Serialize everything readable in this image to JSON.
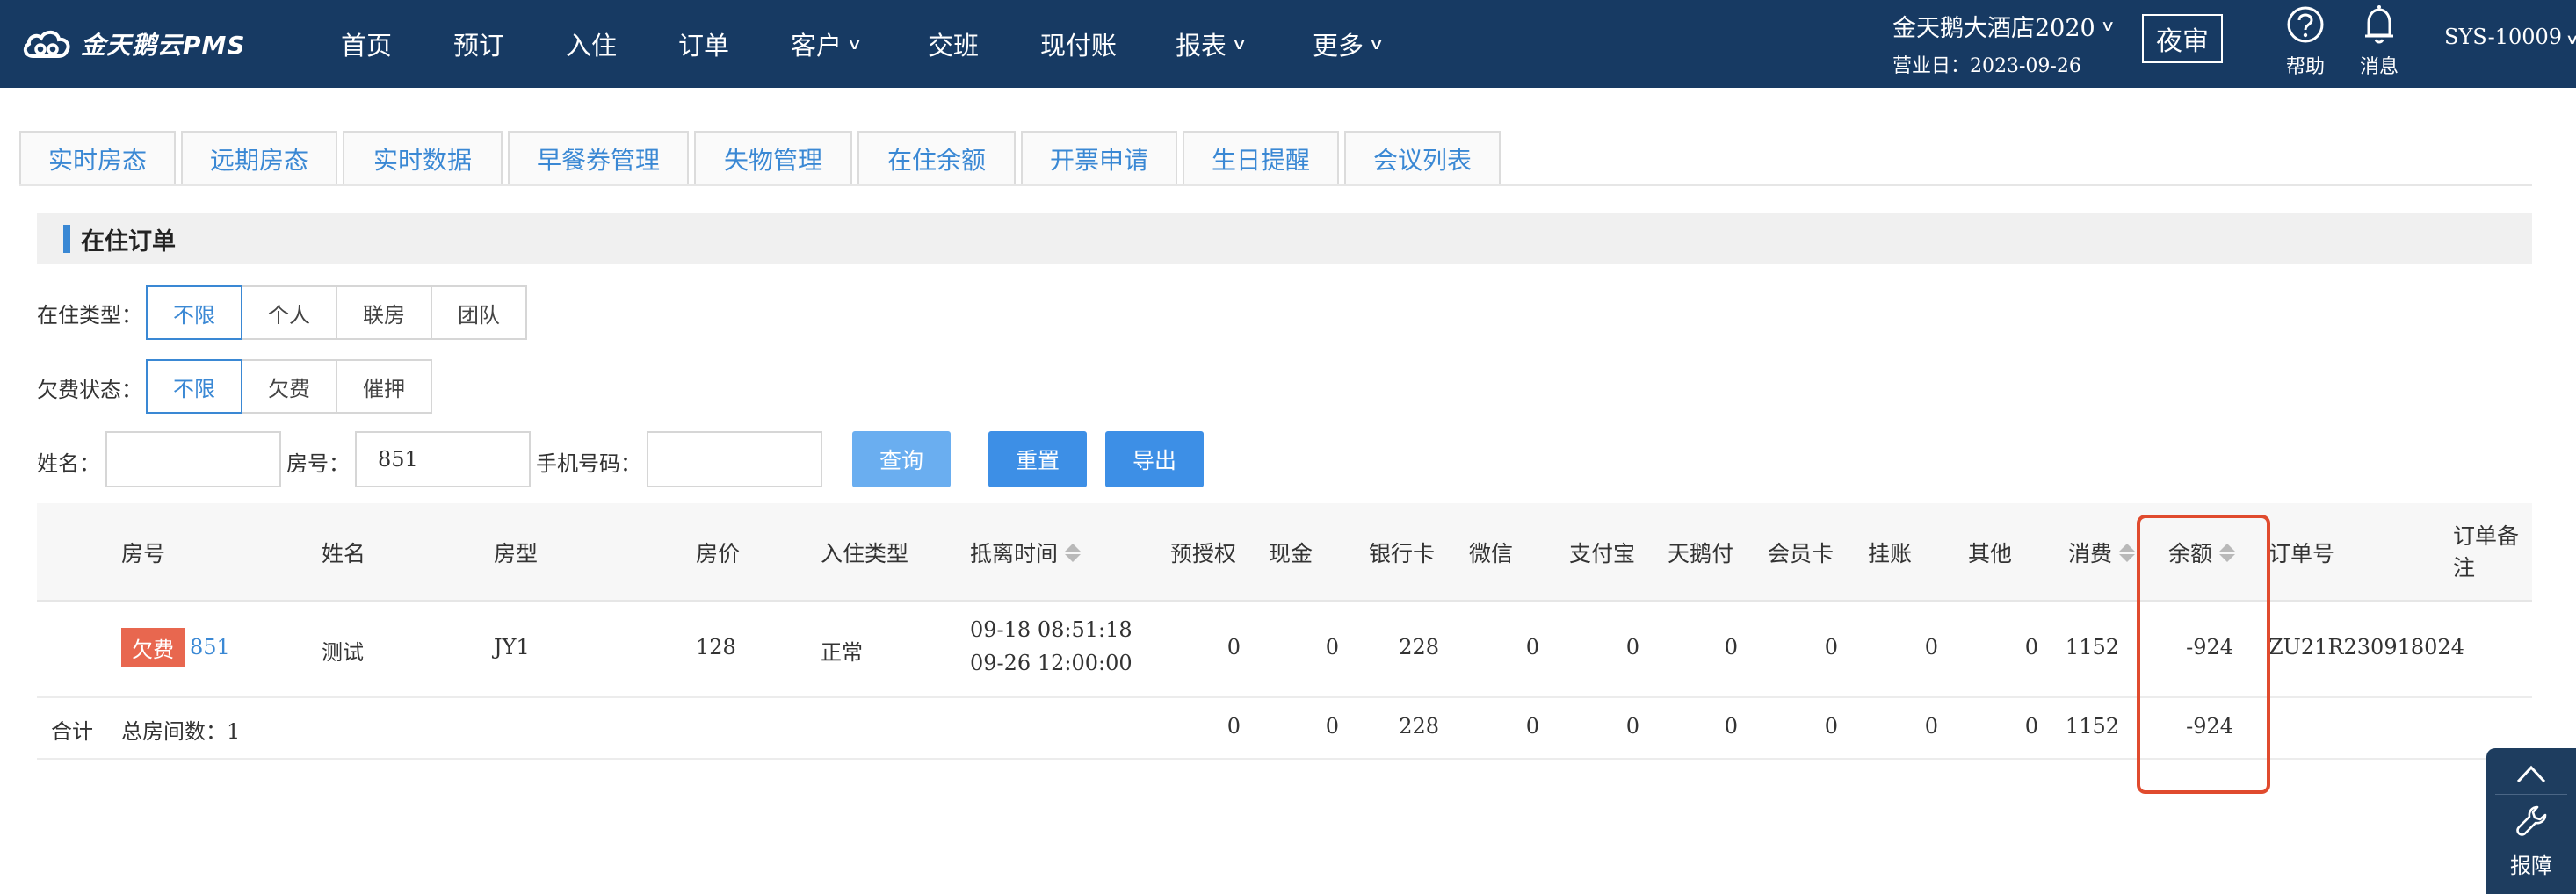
{
  "header": {
    "logo_text": "金天鹅云PMS",
    "nav": [
      {
        "label": "首页",
        "has_menu": false
      },
      {
        "label": "预订",
        "has_menu": false
      },
      {
        "label": "入住",
        "has_menu": false
      },
      {
        "label": "订单",
        "has_menu": false
      },
      {
        "label": "客户",
        "has_menu": true
      },
      {
        "label": "交班",
        "has_menu": false
      },
      {
        "label": "现付账",
        "has_menu": false
      },
      {
        "label": "报表",
        "has_menu": true
      },
      {
        "label": "更多",
        "has_menu": true
      }
    ],
    "hotel_name": "金天鹅大酒店2020",
    "business_date": "营业日：2023-09-26",
    "audit_label": "夜审",
    "help_label": "帮助",
    "message_label": "消息",
    "user": "SYS-10009"
  },
  "tabs": [
    "实时房态",
    "远期房态",
    "实时数据",
    "早餐券管理",
    "失物管理",
    "在住余额",
    "开票申请",
    "生日提醒",
    "会议列表"
  ],
  "section_title": "在住订单",
  "filters": {
    "stay_type_label": "在住类型：",
    "stay_type_options": [
      "不限",
      "个人",
      "联房",
      "团队"
    ],
    "arrears_label": "欠费状态：",
    "arrears_options": [
      "不限",
      "欠费",
      "催押"
    ],
    "name_label": "姓名：",
    "name_value": "",
    "room_label": "房号：",
    "room_value": "851",
    "phone_label": "手机号码：",
    "phone_value": ""
  },
  "buttons": {
    "query": "查询",
    "reset": "重置",
    "export": "导出"
  },
  "table": {
    "columns": [
      "房号",
      "姓名",
      "房型",
      "房价",
      "入住类型",
      "抵离时间",
      "预授权",
      "现金",
      "银行卡",
      "微信",
      "支付宝",
      "天鹅付",
      "会员卡",
      "挂账",
      "其他",
      "消费",
      "余额",
      "订单号",
      "订单备注"
    ],
    "rows": [
      {
        "badge": "欠费",
        "room": "851",
        "name": "测试",
        "room_type": "JY1",
        "price": "128",
        "stay_type": "正常",
        "arrival": "09-18 08:51:18",
        "departure": "09-26 12:00:00",
        "preauth": "0",
        "cash": "0",
        "bank_card": "228",
        "wechat": "0",
        "alipay": "0",
        "swan_pay": "0",
        "member_card": "0",
        "on_account": "0",
        "other": "0",
        "consumption": "1152",
        "balance": "-924",
        "order_no": "ZU21R230918024",
        "remark": ""
      }
    ],
    "total": {
      "label": "合计",
      "room_count": "总房间数：1",
      "preauth": "0",
      "cash": "0",
      "bank_card": "228",
      "wechat": "0",
      "alipay": "0",
      "swan_pay": "0",
      "member_card": "0",
      "on_account": "0",
      "other": "0",
      "consumption": "1152",
      "balance": "-924"
    }
  },
  "float_panel": {
    "report_label": "报障"
  },
  "colors": {
    "header_bg": "#173a63",
    "accent": "#3a88d4",
    "badge": "#e8674f",
    "highlight": "#e04b2e"
  }
}
